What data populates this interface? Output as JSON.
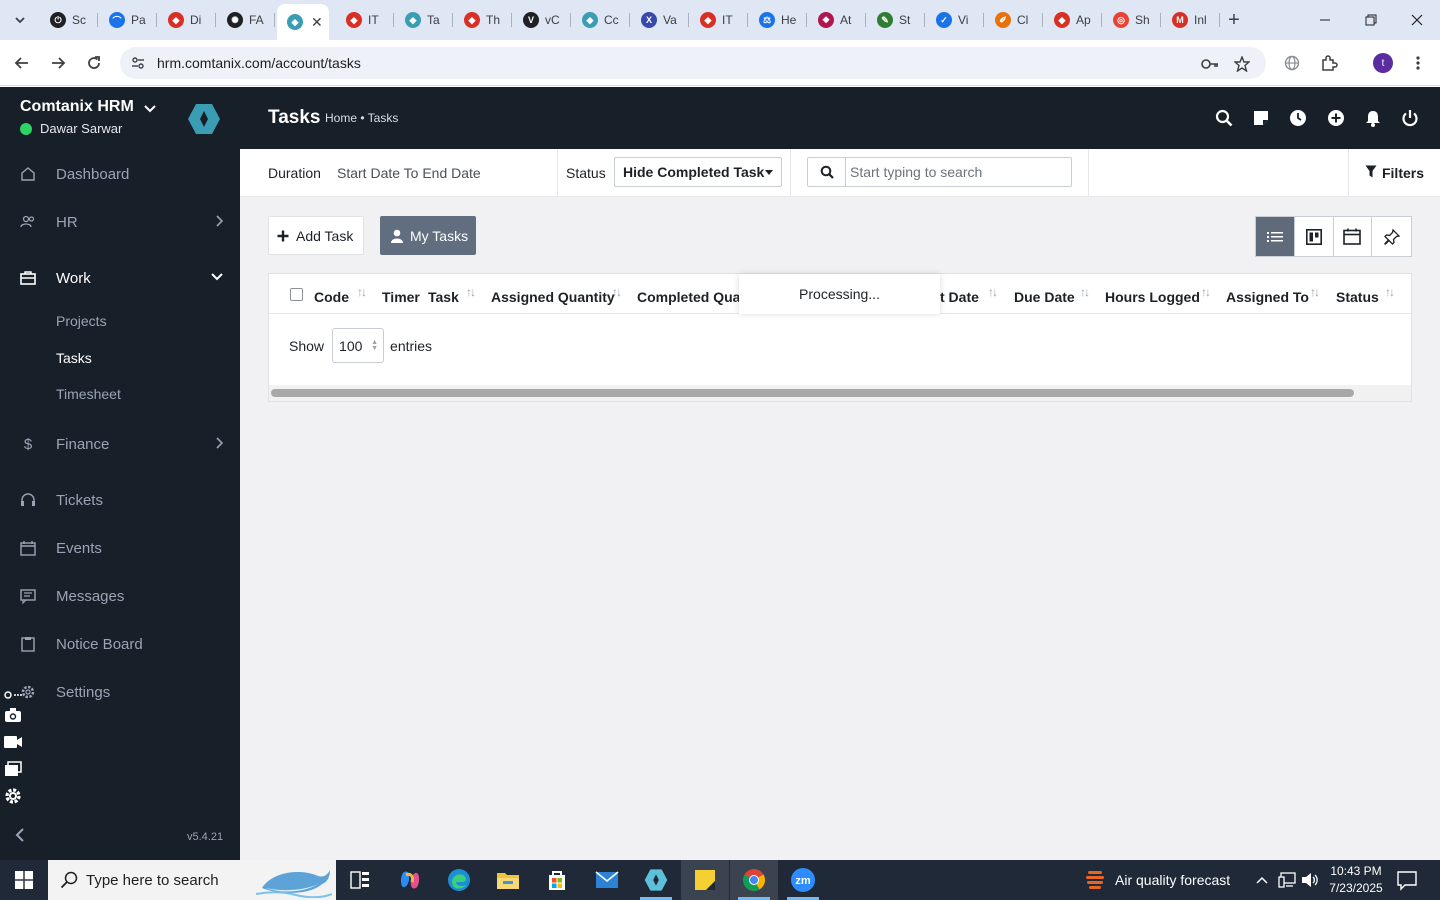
{
  "browser": {
    "tabs": [
      {
        "label": "Sc",
        "color": "#202124",
        "glyph": "⏻"
      },
      {
        "label": "Pa",
        "color": "#1a73e8",
        "glyph": "⌒"
      },
      {
        "label": "Di",
        "color": "#d93025",
        "glyph": "◆"
      },
      {
        "label": "FA",
        "color": "#202124",
        "glyph": "✺"
      },
      {
        "label": "",
        "color": "#3b9db4",
        "glyph": "◆",
        "active": true
      },
      {
        "label": "IT",
        "color": "#d93025",
        "glyph": "◆"
      },
      {
        "label": "Ta",
        "color": "#3b9db4",
        "glyph": "◆"
      },
      {
        "label": "Th",
        "color": "#d93025",
        "glyph": "◆"
      },
      {
        "label": "vC",
        "color": "#202124",
        "glyph": "V"
      },
      {
        "label": "Cc",
        "color": "#3b9db4",
        "glyph": "◆"
      },
      {
        "label": "Va",
        "color": "#3949ab",
        "glyph": "X"
      },
      {
        "label": "IT",
        "color": "#d93025",
        "glyph": "◆"
      },
      {
        "label": "He",
        "color": "#1a73e8",
        "glyph": "⚖"
      },
      {
        "label": "At",
        "color": "#b0174f",
        "glyph": "❖"
      },
      {
        "label": "St",
        "color": "#2e7d32",
        "glyph": "✎"
      },
      {
        "label": "Vi",
        "color": "#1a73e8",
        "glyph": "✓"
      },
      {
        "label": "Cl",
        "color": "#e8710a",
        "glyph": "✐"
      },
      {
        "label": "Ap",
        "color": "#d93025",
        "glyph": "◆"
      },
      {
        "label": "Sh",
        "color": "#ea4335",
        "glyph": "◎"
      },
      {
        "label": "Inl",
        "color": "#d93025",
        "glyph": "M"
      }
    ],
    "url": "hrm.comtanix.com/account/tasks"
  },
  "sidebar": {
    "brand": "Comtanix HRM",
    "user": "Dawar Sarwar",
    "items": [
      {
        "label": "Dashboard"
      },
      {
        "label": "HR"
      },
      {
        "label": "Work"
      },
      {
        "label": "Finance"
      },
      {
        "label": "Tickets"
      },
      {
        "label": "Events"
      },
      {
        "label": "Messages"
      },
      {
        "label": "Notice Board"
      },
      {
        "label": "Settings"
      }
    ],
    "work_sub": [
      {
        "label": "Projects"
      },
      {
        "label": "Tasks"
      },
      {
        "label": "Timesheet"
      }
    ],
    "version": "v5.4.21"
  },
  "header": {
    "title": "Tasks",
    "breadcrumb": "Home • Tasks"
  },
  "filters": {
    "duration_label": "Duration",
    "duration_value": "Start Date To End Date",
    "status_label": "Status",
    "status_value": "Hide Completed Task",
    "search_placeholder": "Start typing to search",
    "filters_label": "Filters"
  },
  "actions": {
    "add_task": "Add Task",
    "my_tasks": "My Tasks"
  },
  "table": {
    "columns": [
      "Code",
      "Timer",
      "Task",
      "Assigned Quantity",
      "Completed Quan",
      "t Date",
      "Due Date",
      "Hours Logged",
      "Assigned To",
      "Status"
    ],
    "processing": "Processing...",
    "show_label": "Show",
    "page_length": "100",
    "entries_label": "entries"
  },
  "taskbar": {
    "search_placeholder": "Type here to search",
    "weather": "Air quality forecast",
    "time": "10:43 PM",
    "date": "7/23/2025"
  }
}
